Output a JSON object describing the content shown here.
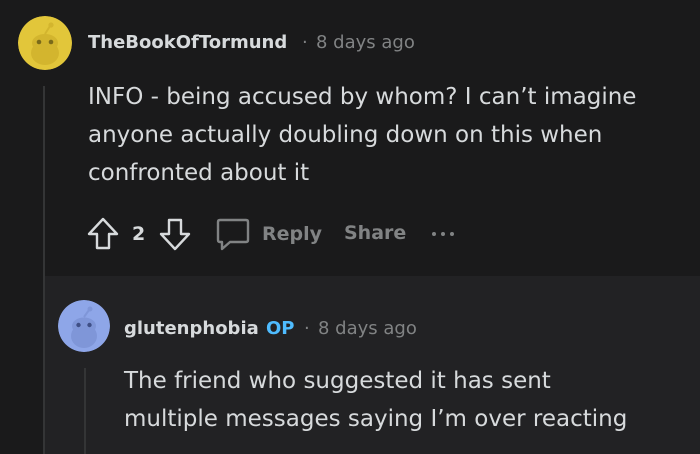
{
  "comments": [
    {
      "username": "TheBookOfTormund",
      "separator": "·",
      "time": "8 days ago",
      "body_lines": [
        "INFO - being accused by whom? I can’t imagine",
        "anyone actually doubling down on this when",
        "confronted about it"
      ],
      "votes": "2",
      "reply_label": "Reply",
      "share_label": "Share",
      "avatar_color": "#e2c63a"
    },
    {
      "username": "glutenphobia",
      "op_badge": "OP",
      "separator": "·",
      "time": "8 days ago",
      "body_lines": [
        "The friend who suggested it has sent",
        "multiple messages saying I’m over reacting"
      ],
      "avatar_color": "#8ea6e8"
    }
  ],
  "colors": {
    "background": "#1a1a1b",
    "reply_background": "#222224",
    "text": "#d7dadc",
    "muted": "#818384",
    "op": "#4fbcff"
  }
}
